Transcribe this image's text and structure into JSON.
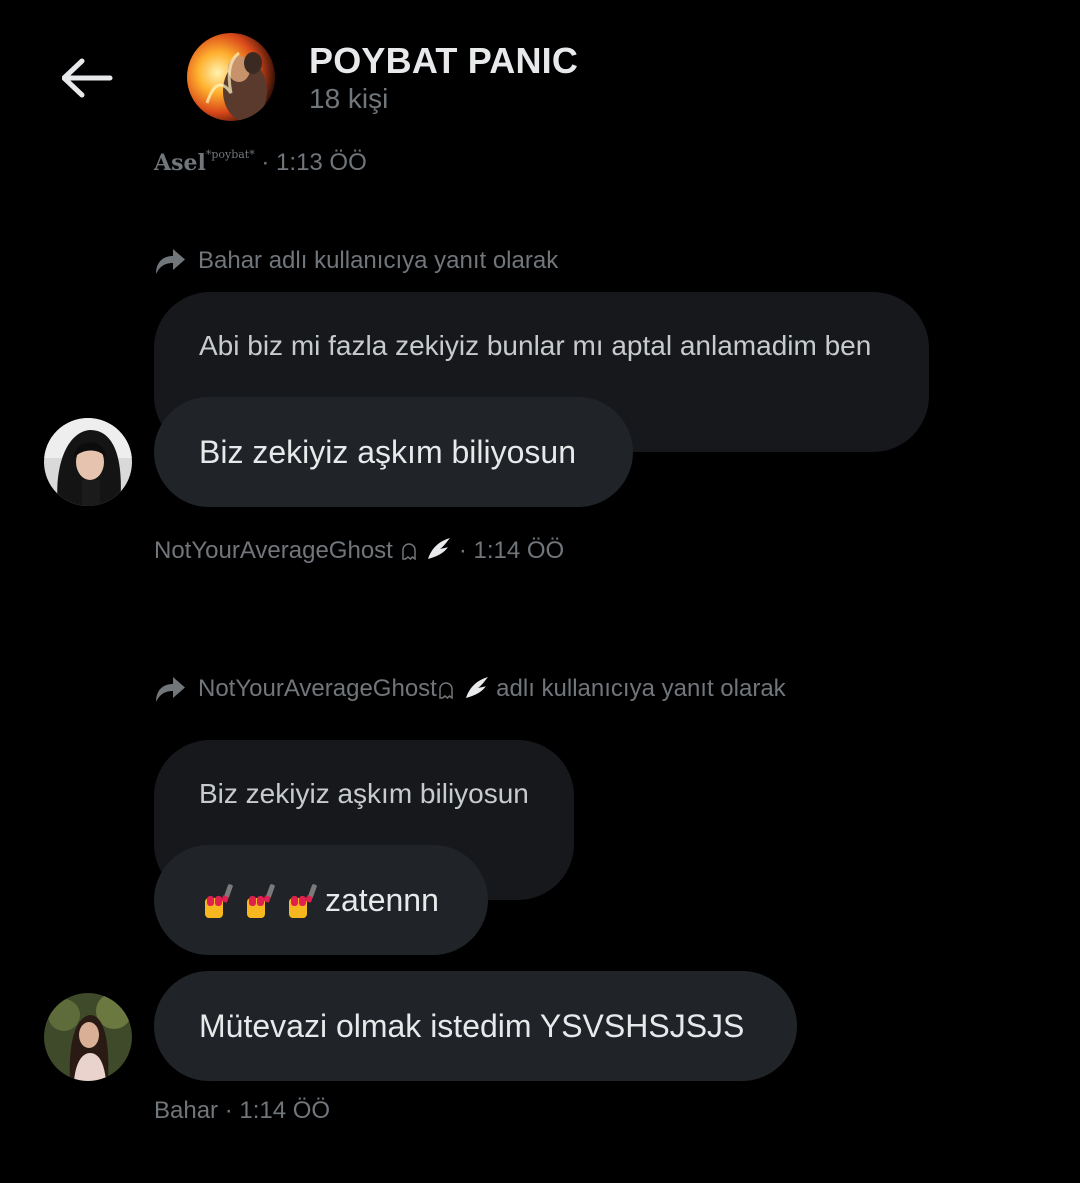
{
  "header": {
    "title": "POYBAT PANIC",
    "subtitle": "18 kişi"
  },
  "messages": [
    {
      "sender": "Asel",
      "sender_sup": "*poybat*",
      "time": "· 1:13 ÖÖ"
    },
    {
      "reply_context": "Bahar adlı kullanıcıya yanıt olarak",
      "quoted_text": "Abi biz mi fazla zekiyiz bunlar mı aptal anlamadim ben",
      "text": "Biz zekiyiz aşkım biliyosun",
      "sender": "NotYourAverageGhost",
      "sender_emoji": "👻🪽",
      "time": "· 1:14 ÖÖ"
    },
    {
      "reply_context_user": "NotYourAverageGhost",
      "reply_context_emoji": "👻🪽",
      "reply_context_suffix": "adlı kullanıcıya yanıt olarak",
      "quoted_text": "Biz zekiyiz aşkım biliyosun",
      "text_emojis": "💅💅💅",
      "text": "zatennn"
    },
    {
      "text": "Mütevazi olmak istedim YSVSHSJSJS",
      "sender": "Bahar",
      "time": "· 1:14 ÖÖ"
    }
  ],
  "colors": {
    "background": "#000000",
    "bubble": "#202327",
    "quoted_bubble": "#16181c",
    "primary_text": "#e7e9ea",
    "secondary_text": "#71767b"
  },
  "icons": {
    "back": "arrow-left-icon",
    "reply": "reply-arrow-icon",
    "nails": "nail-polish-emoji",
    "wing": "wing-emoji"
  }
}
